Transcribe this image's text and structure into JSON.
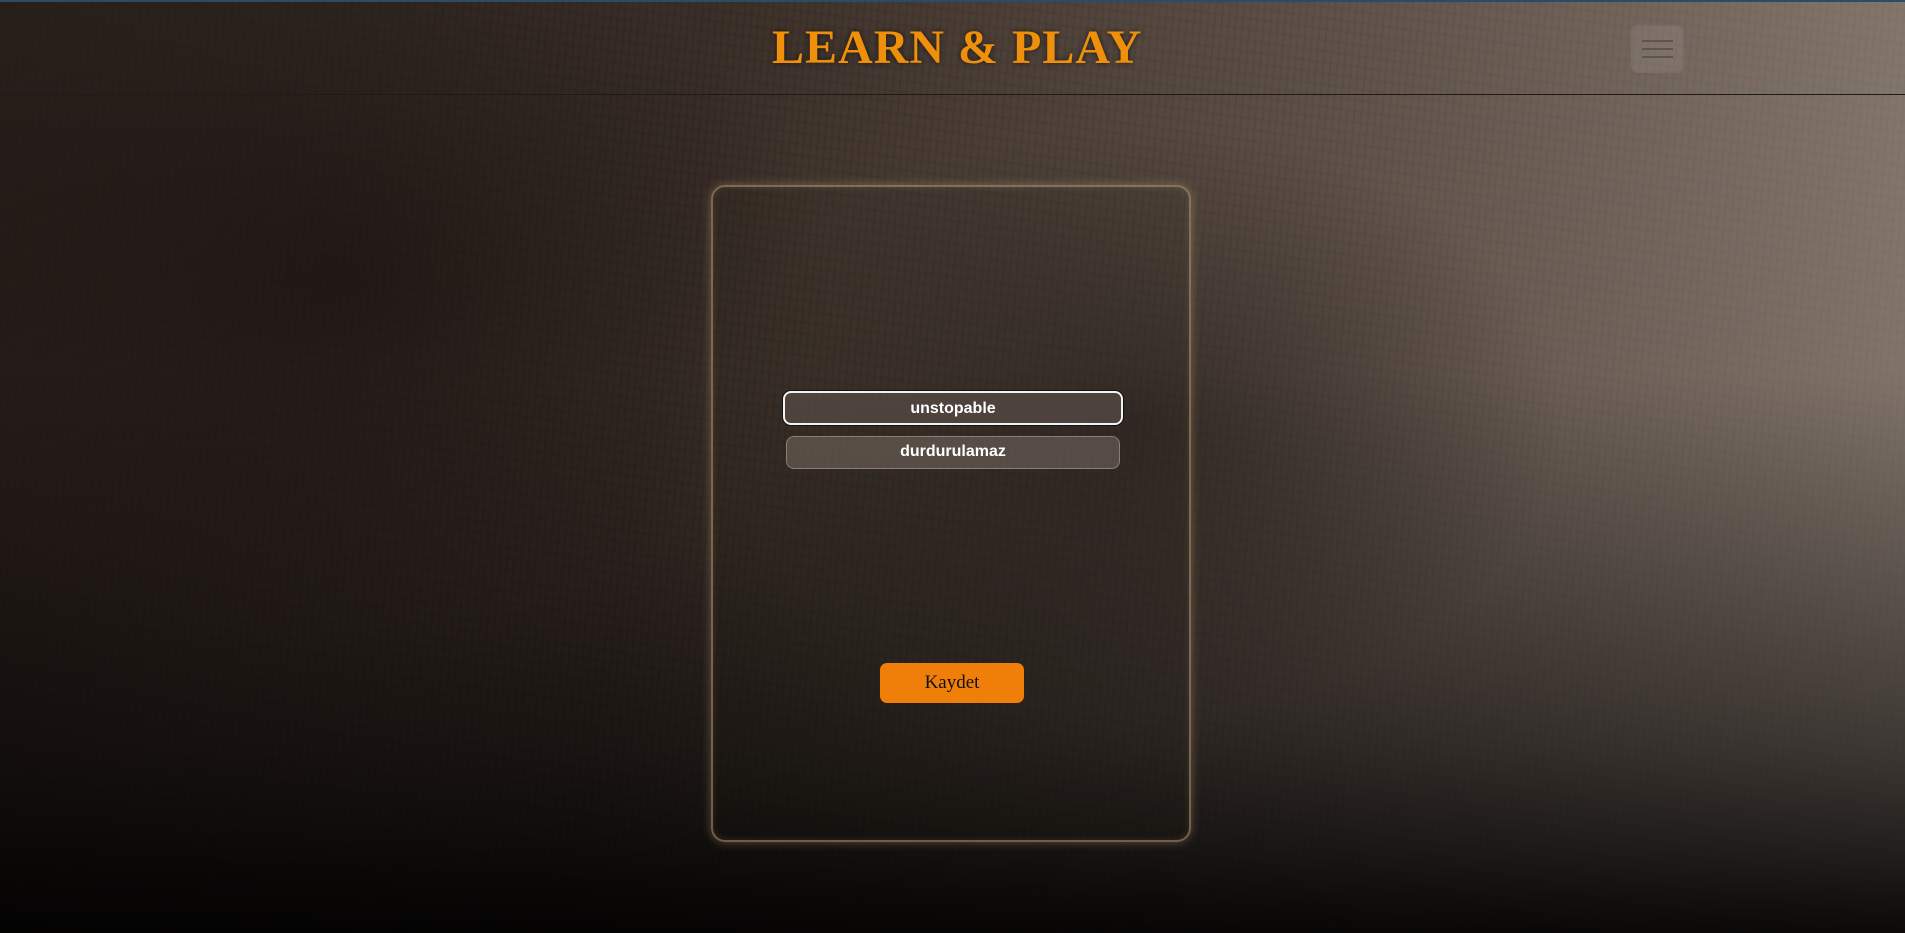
{
  "navbar": {
    "brand": "LEARN & PLAY",
    "menu_icon": "hamburger-menu-icon"
  },
  "card": {
    "word_en": "unstopable",
    "word_tr": "durdurulamaz",
    "save_label": "Kaydet"
  },
  "colors": {
    "brand": "#f0900a",
    "button": "#f07f0a",
    "card_border": "#bea078"
  }
}
